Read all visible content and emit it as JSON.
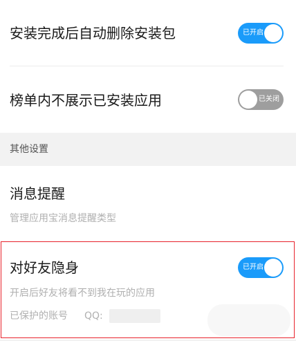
{
  "settings": {
    "auto_delete": {
      "title": "安装完成后自动删除安装包",
      "toggle_label": "已开启"
    },
    "hide_installed": {
      "title": "榜单内不展示已安装应用",
      "toggle_label": "已关闭"
    }
  },
  "section": {
    "other_settings": "其他设置"
  },
  "message_reminder": {
    "title": "消息提醒",
    "subtitle": "管理应用宝消息提醒类型"
  },
  "invisible_friends": {
    "title": "对好友隐身",
    "subtitle": "开启后好友将看不到我在玩的应用",
    "account_label": "已保护的账号",
    "qq_label": "QQ:",
    "toggle_label": "已开启"
  },
  "colors": {
    "accent": "#1a9bfa",
    "toggle_off": "#9e9e9e",
    "highlight": "#e8202a"
  }
}
